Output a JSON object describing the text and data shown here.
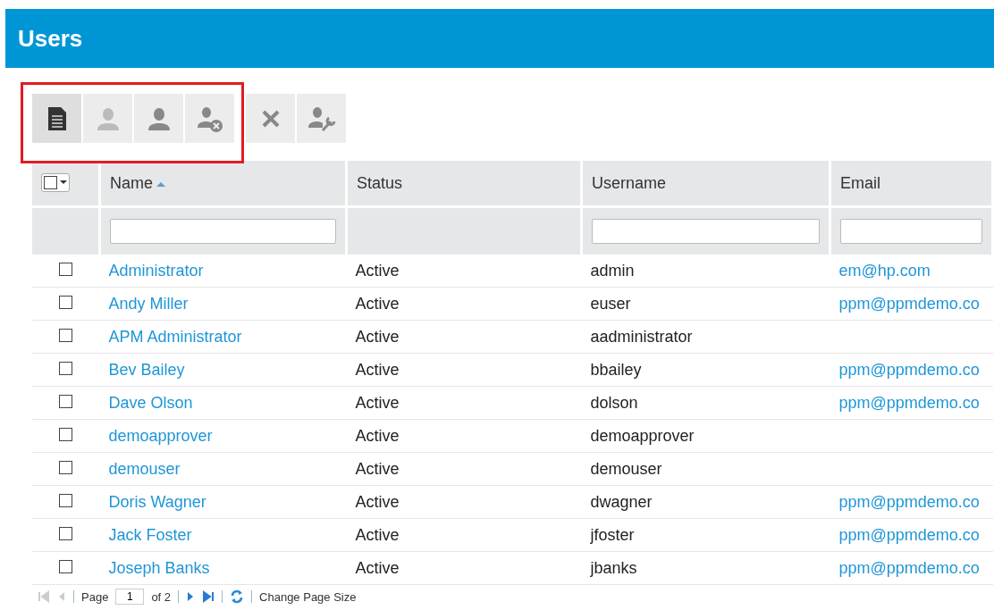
{
  "header": {
    "title": "Users"
  },
  "toolbar": {
    "buttons": [
      {
        "kind": "document",
        "disabled": false,
        "highlighted": true
      },
      {
        "kind": "person",
        "disabled": true,
        "highlighted": true
      },
      {
        "kind": "person",
        "disabled": false,
        "highlighted": true
      },
      {
        "kind": "person-remove",
        "disabled": false,
        "highlighted": true
      },
      {
        "kind": "delete",
        "disabled": false,
        "highlighted": false
      },
      {
        "kind": "person-tool",
        "disabled": false,
        "highlighted": false
      }
    ]
  },
  "table": {
    "columns": [
      {
        "label": "Name",
        "sorted": true,
        "filter": true
      },
      {
        "label": "Status",
        "sorted": false,
        "filter": false
      },
      {
        "label": "Username",
        "sorted": false,
        "filter": true
      },
      {
        "label": "Email",
        "sorted": false,
        "filter": true
      }
    ],
    "rows": [
      {
        "checked": false,
        "name": "Administrator",
        "status": "Active",
        "username": "admin",
        "email": "em@hp.com"
      },
      {
        "checked": false,
        "name": "Andy Miller",
        "status": "Active",
        "username": "euser",
        "email": "ppm@ppmdemo.co"
      },
      {
        "checked": false,
        "name": "APM Administrator",
        "status": "Active",
        "username": "aadministrator",
        "email": ""
      },
      {
        "checked": false,
        "name": "Bev Bailey",
        "status": "Active",
        "username": "bbailey",
        "email": "ppm@ppmdemo.co"
      },
      {
        "checked": false,
        "name": "Dave Olson",
        "status": "Active",
        "username": "dolson",
        "email": "ppm@ppmdemo.co"
      },
      {
        "checked": false,
        "name": "demoapprover",
        "status": "Active",
        "username": "demoapprover",
        "email": ""
      },
      {
        "checked": false,
        "name": "demouser",
        "status": "Active",
        "username": "demouser",
        "email": ""
      },
      {
        "checked": false,
        "name": "Doris Wagner",
        "status": "Active",
        "username": "dwagner",
        "email": "ppm@ppmdemo.co"
      },
      {
        "checked": false,
        "name": "Jack Foster",
        "status": "Active",
        "username": "jfoster",
        "email": "ppm@ppmdemo.co"
      },
      {
        "checked": false,
        "name": "Joseph Banks",
        "status": "Active",
        "username": "jbanks",
        "email": "ppm@ppmdemo.co"
      }
    ]
  },
  "pager": {
    "page_label": "Page",
    "page": "1",
    "of_label": "of 2",
    "change_size": "Change Page Size"
  }
}
